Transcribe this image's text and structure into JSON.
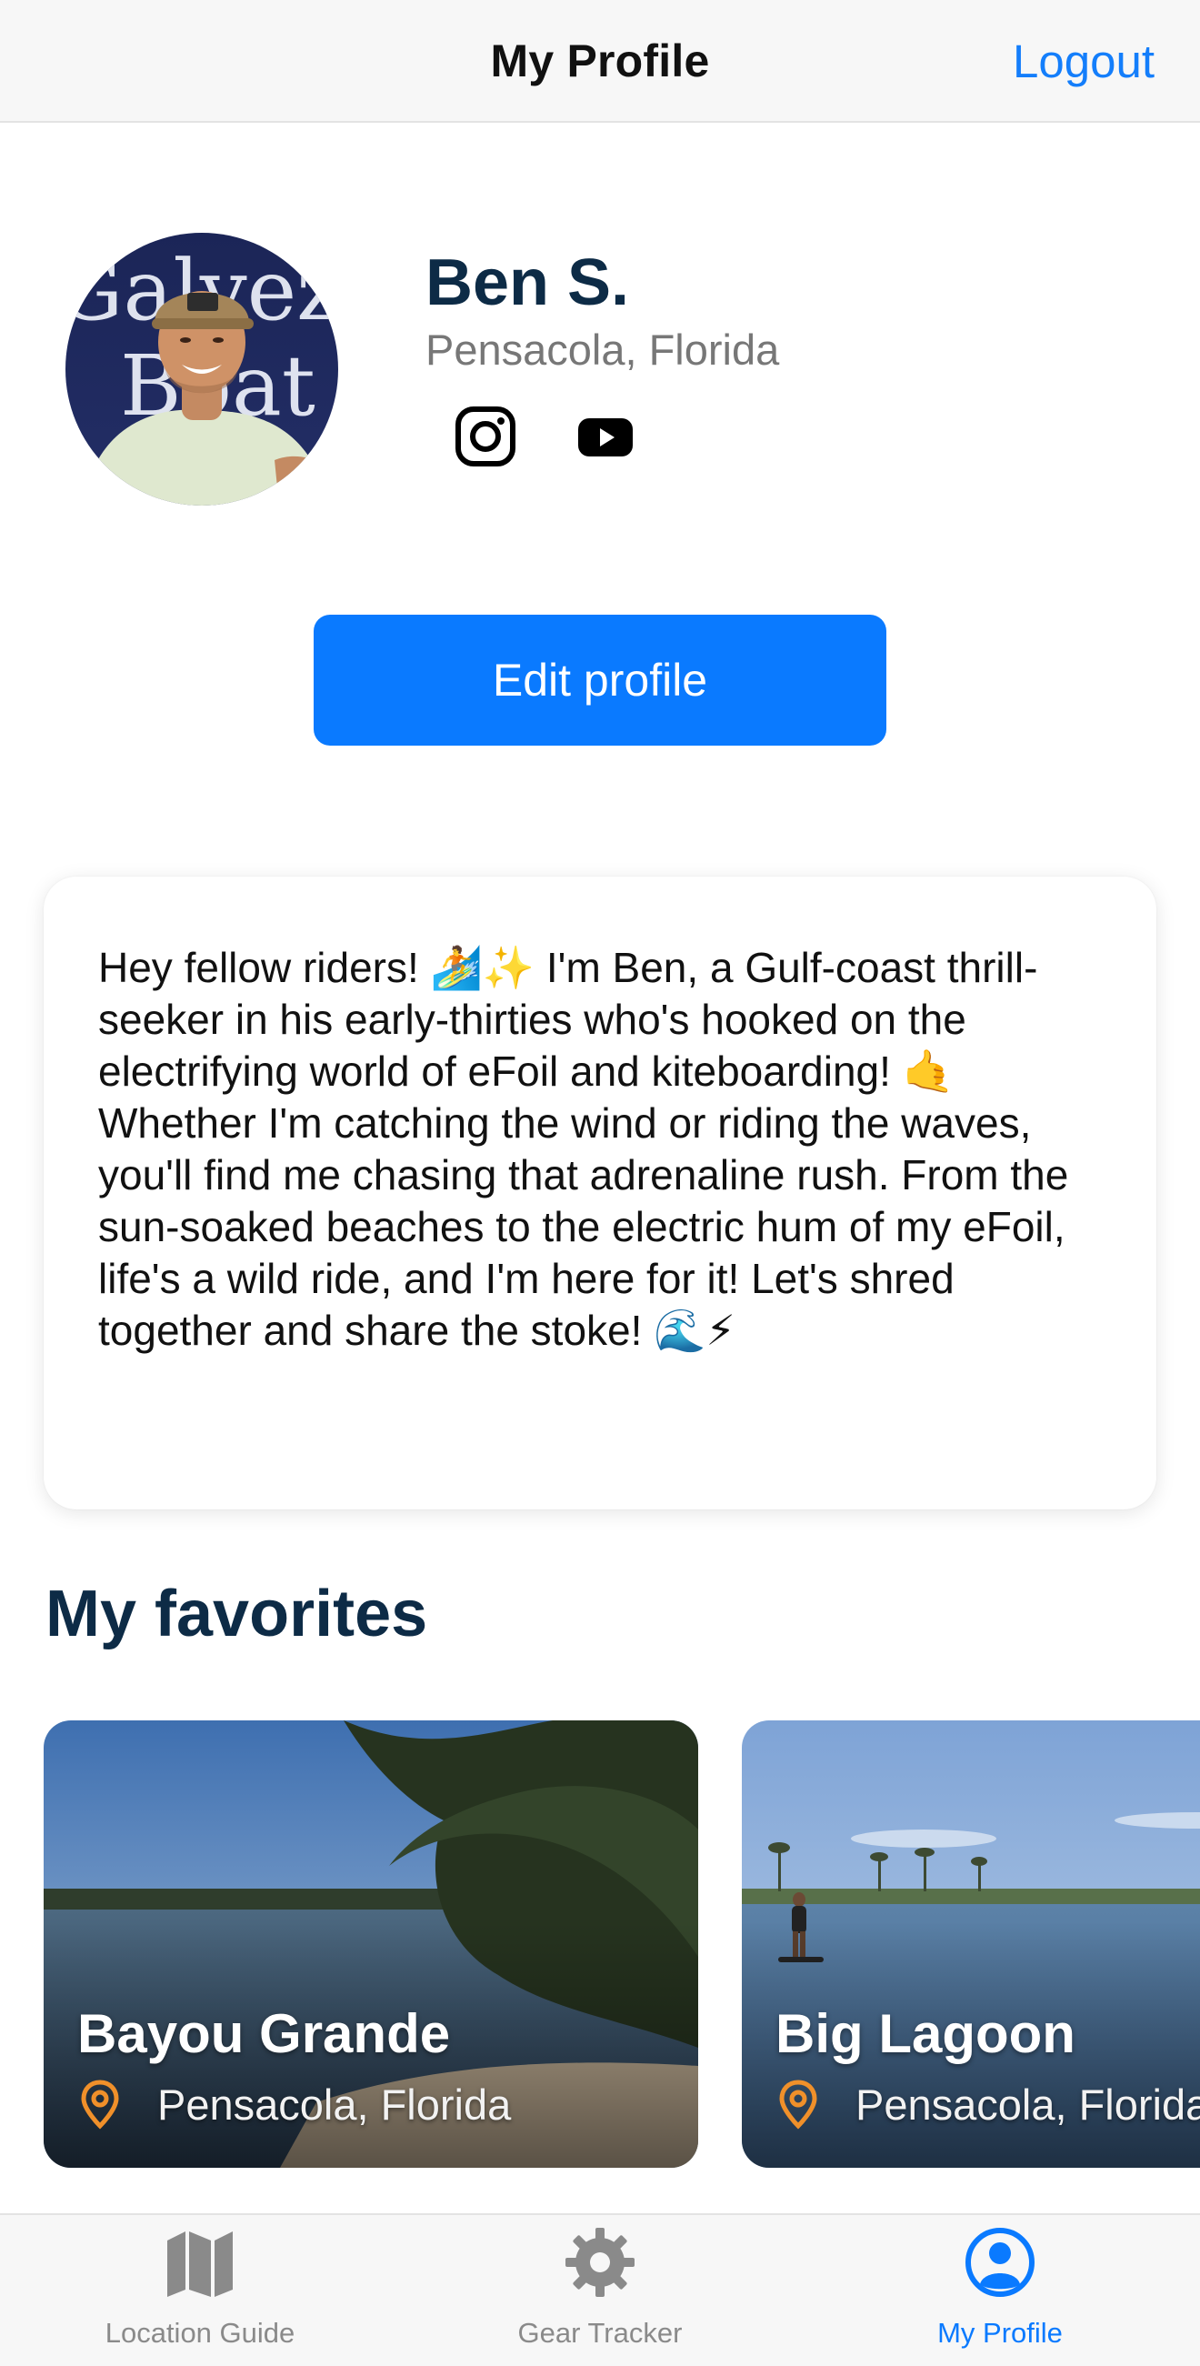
{
  "header": {
    "title": "My Profile",
    "logout_label": "Logout"
  },
  "profile": {
    "name": "Ben S.",
    "location": "Pensacola, Florida",
    "social_icons": [
      "instagram-icon",
      "youtube-icon"
    ],
    "edit_label": "Edit profile",
    "bio": "Hey fellow riders! 🏄✨ I'm Ben, a Gulf-coast thrill-seeker in his early-thirties who's hooked on the electrifying world of eFoil and kiteboarding! 🤙 Whether I'm catching the wind or riding the waves, you'll find me chasing that adrenaline rush. From the sun-soaked beaches to the electric hum of my eFoil, life's a wild ride, and I'm here for it! Let's shred together and share the stoke! 🌊⚡"
  },
  "favorites": {
    "title": "My favorites",
    "items": [
      {
        "name": "Bayou Grande",
        "location": "Pensacola, Florida"
      },
      {
        "name": "Big Lagoon",
        "location": "Pensacola, Florida"
      }
    ]
  },
  "tabs": [
    {
      "label": "Location Guide",
      "icon": "map-icon",
      "active": false
    },
    {
      "label": "Gear Tracker",
      "icon": "gear-icon",
      "active": false
    },
    {
      "label": "My Profile",
      "icon": "profile-icon",
      "active": true
    }
  ],
  "colors": {
    "accent": "#0a7aff",
    "heading": "#0d2b46",
    "pin": "#f0902a",
    "muted": "#8a8a8a"
  }
}
